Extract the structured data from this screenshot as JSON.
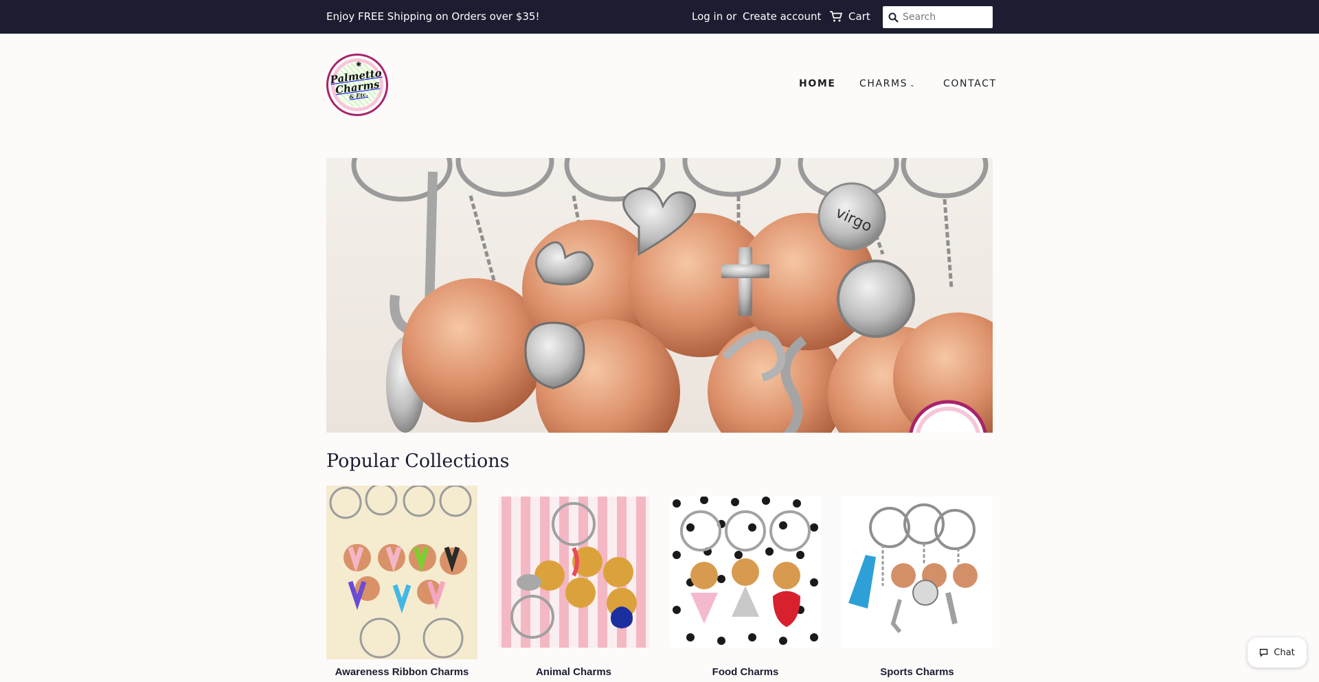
{
  "announcement": {
    "promo_text": "Enjoy FREE Shipping on Orders over $35!"
  },
  "account": {
    "login_label": "Log in",
    "or_text": "or",
    "create_label": "Create account"
  },
  "cart": {
    "label": "Cart",
    "icon": "cart-icon"
  },
  "search": {
    "placeholder": "Search",
    "value": "",
    "icon": "search-icon"
  },
  "logo": {
    "line1": "Palmetto",
    "line2": "Charms",
    "line3": "& Etc."
  },
  "nav": {
    "items": [
      {
        "label": "HOME",
        "active": true
      },
      {
        "label": "CHARMS",
        "has_dropdown": true
      },
      {
        "label": "CONTACT"
      }
    ]
  },
  "hero": {
    "alt": "Penny keychains with charms"
  },
  "popular": {
    "title": "Popular Collections",
    "collections": [
      {
        "label": "Awareness Ribbon Charms"
      },
      {
        "label": "Animal Charms"
      },
      {
        "label": "Food Charms"
      },
      {
        "label": "Sports Charms"
      }
    ]
  },
  "chat": {
    "label": "Chat",
    "icon": "chat-icon"
  },
  "colors": {
    "topbar": "#1c1d30",
    "accent": "#a8236b",
    "background": "#fdfafa"
  }
}
